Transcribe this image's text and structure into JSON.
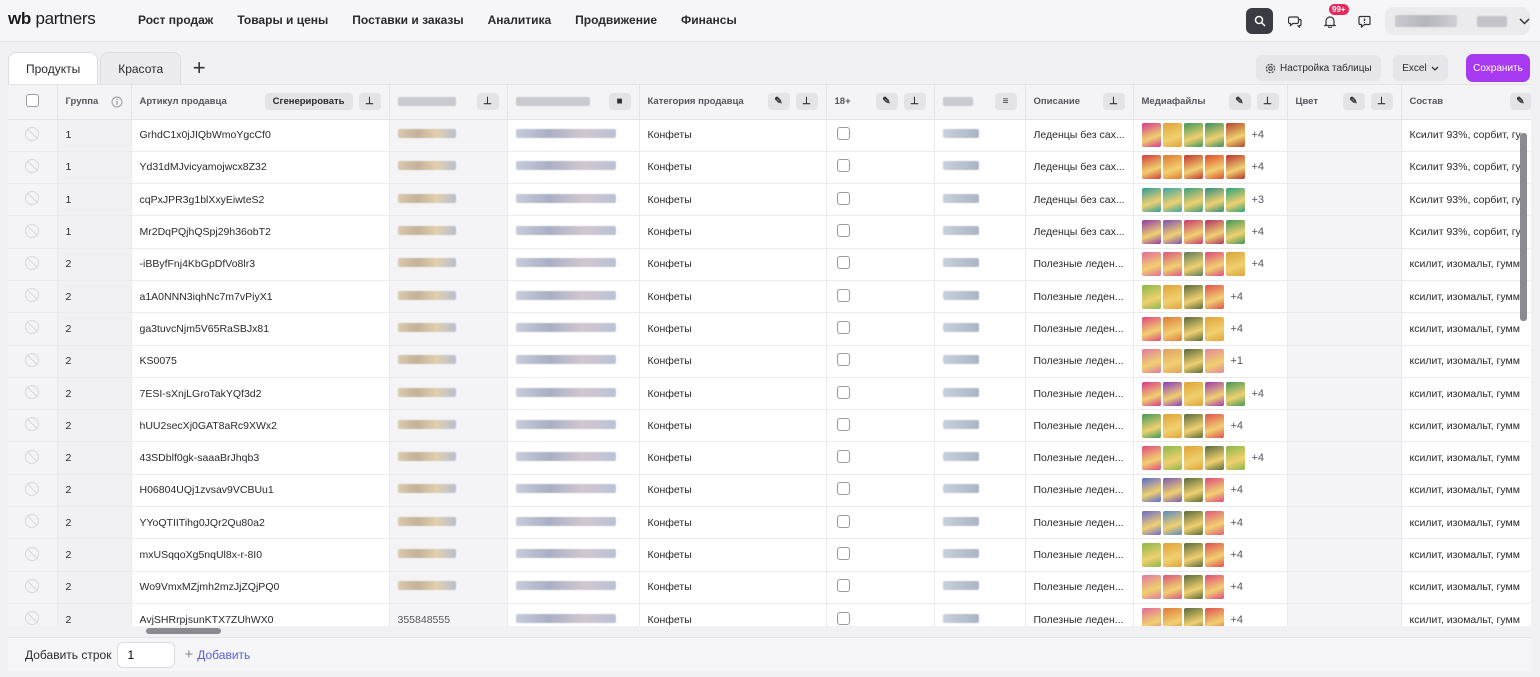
{
  "topbar": {
    "logo_wb": "wb",
    "logo_partners": "partners",
    "nav": [
      "Рост продаж",
      "Товары и цены",
      "Поставки и заказы",
      "Аналитика",
      "Продвижение",
      "Финансы"
    ],
    "notif_badge": "99+"
  },
  "tabs": {
    "items": [
      "Продукты",
      "Красота"
    ],
    "add": "+"
  },
  "toolbar": {
    "settings": "Настройка таблицы",
    "excel": "Excel",
    "save": "Сохранить"
  },
  "columns": {
    "group": "Группа",
    "article": "Артикул продавца",
    "generate": "Сгенерировать",
    "category": "Категория продавца",
    "age": "18+",
    "description": "Описание",
    "media": "Медиафайлы",
    "color": "Цвет",
    "composition": "Состав"
  },
  "rows": [
    {
      "group": "1",
      "article": "GrhdC1x0jJIQbWmoYgcCf0",
      "category": "Конфеты",
      "description": "Леденцы без сах...",
      "more": "+4",
      "composition": "Ксилит 93%, сорбит, гу",
      "thumbs": [
        "#d53a8d",
        "#e0a437",
        "#3f9a57",
        "#3b8d60",
        "#b1452f"
      ]
    },
    {
      "group": "1",
      "article": "Yd31dMJvicyamojwcx8Z32",
      "category": "Конфеты",
      "description": "Леденцы без сах...",
      "more": "+4",
      "composition": "Ксилит 93%, сорбит, гу",
      "thumbs": [
        "#d03e3b",
        "#e0782f",
        "#c5332e",
        "#e04a2a",
        "#b93030"
      ]
    },
    {
      "group": "1",
      "article": "cqPxJPR3g1blXxyEiwteS2",
      "category": "Конфеты",
      "description": "Леденцы без сах...",
      "more": "+3",
      "composition": "Ксилит 93%, сорбит, гу",
      "thumbs": [
        "#2d9c9b",
        "#38a8a2",
        "#3b9e7c",
        "#2f8e7d",
        "#2aa37a"
      ]
    },
    {
      "group": "1",
      "article": "Mr2DqPQjhQSpj29h36obT2",
      "category": "Конфеты",
      "description": "Леденцы без сах...",
      "more": "+4",
      "composition": "Ксилит 93%, сорбит, гу",
      "thumbs": [
        "#8e3aa8",
        "#7d4fb5",
        "#c73a6d",
        "#b03462",
        "#3f9a57"
      ]
    },
    {
      "group": "2",
      "article": "-iBByfFnj4KbGpDfVo8lr3",
      "category": "Конфеты",
      "description": "Полезные леден...",
      "more": "+4",
      "composition": "ксилит, изомальт, гумм",
      "thumbs": [
        "#e46a9a",
        "#d9567f",
        "#5a7a5a",
        "#e0497e",
        "#d9a43a"
      ]
    },
    {
      "group": "2",
      "article": "a1A0NNN3iqhNc7m7vPiyX1",
      "category": "Конфеты",
      "description": "Полезные леден...",
      "more": "+4",
      "composition": "ксилит, изомальт, гумм",
      "thumbs": [
        "#8bb84a",
        "#e0a437",
        "#5a6a3a",
        "#e05050"
      ]
    },
    {
      "group": "2",
      "article": "ga3tuvcNjm5V65RaSBJx81",
      "category": "Конфеты",
      "description": "Полезные леден...",
      "more": "+4",
      "composition": "ксилит, изомальт, гумм",
      "thumbs": [
        "#e0497e",
        "#e07a3a",
        "#5a6a3a",
        "#e0a437"
      ]
    },
    {
      "group": "2",
      "article": "KS0075",
      "category": "Конфеты",
      "description": "Полезные леден...",
      "more": "+1",
      "composition": "ксилит, изомальт, гумм",
      "thumbs": [
        "#e07aa0",
        "#e0a060",
        "#5a6a3a",
        "#e5869a"
      ]
    },
    {
      "group": "2",
      "article": "7ESI-sXnjLGroTakYQf3d2",
      "category": "Конфеты",
      "description": "Полезные леден...",
      "more": "+4",
      "composition": "ксилит, изомальт, гумм",
      "thumbs": [
        "#d93a8a",
        "#8a3ac0",
        "#e0a437",
        "#a03ab0",
        "#3f9a57"
      ]
    },
    {
      "group": "2",
      "article": "hUU2secXj0GAT8aRc9XWx2",
      "category": "Конфеты",
      "description": "Полезные леден...",
      "more": "+4",
      "composition": "ксилит, изомальт, гумм",
      "thumbs": [
        "#3f9a57",
        "#e0a437",
        "#5a6a3a",
        "#e05050"
      ]
    },
    {
      "group": "2",
      "article": "43SDblf0gk-saaaBrJhqb3",
      "category": "Конфеты",
      "description": "Полезные леден...",
      "more": "+4",
      "composition": "ксилит, изомальт, гумм",
      "thumbs": [
        "#e0497e",
        "#8bb84a",
        "#e0a437",
        "#5a6a3a",
        "#8bb84a"
      ]
    },
    {
      "group": "2",
      "article": "H06804UQj1zvsav9VCBUu1",
      "category": "Конфеты",
      "description": "Полезные леден...",
      "more": "+4",
      "composition": "ксилит, изомальт, гумм",
      "thumbs": [
        "#5a6ad0",
        "#7a5ab0",
        "#5a6a3a",
        "#e0497e"
      ]
    },
    {
      "group": "2",
      "article": "YYoQTIITihg0JQr2Qu80a2",
      "category": "Конфеты",
      "description": "Полезные леден...",
      "more": "+4",
      "composition": "ксилит, изомальт, гумм",
      "thumbs": [
        "#6a6ad0",
        "#5a8ac0",
        "#5a6a3a",
        "#e05a7a"
      ]
    },
    {
      "group": "2",
      "article": "mxUSqqoXg5nqUl8x-r-8I0",
      "category": "Конфеты",
      "description": "Полезные леден...",
      "more": "+4",
      "composition": "ксилит, изомальт, гумм",
      "thumbs": [
        "#8bb84a",
        "#e0a437",
        "#5a6a3a",
        "#e05050"
      ]
    },
    {
      "group": "2",
      "article": "Wo9VmxMZjmh2mzJjZQjPQ0",
      "category": "Конфеты",
      "description": "Полезные леден...",
      "more": "+4",
      "composition": "ксилит, изомальт, гумм",
      "thumbs": [
        "#e07aa0",
        "#d9567f",
        "#5a6a3a",
        "#e0497e"
      ]
    },
    {
      "group": "2",
      "article": "AvjSHRrpjsunKTX7ZUhWX0",
      "category": "Конфеты",
      "description": "Полезные леден...",
      "more": "+4",
      "composition": "ксилит, изомальт, гумм",
      "barcode": "355848555",
      "thumbs": [
        "#e46a9a",
        "#e07a3a",
        "#5a6a3a",
        "#e05050"
      ]
    }
  ],
  "footer": {
    "label": "Добавить строк",
    "value": "1",
    "add": "Добавить"
  },
  "colors": {
    "accent": "#a73af0",
    "link": "#5b5bd6",
    "badge": "#e8285b"
  }
}
